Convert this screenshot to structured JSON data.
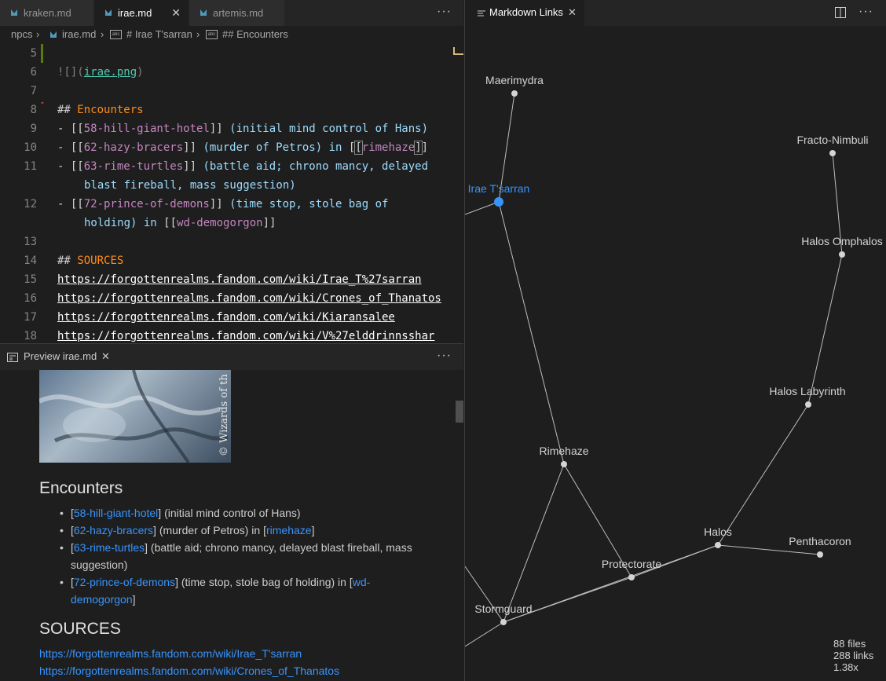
{
  "tabs": [
    {
      "label": "kraken.md"
    },
    {
      "label": "irae.md"
    },
    {
      "label": "artemis.md"
    }
  ],
  "breadcrumb": {
    "folder": "npcs",
    "file": "irae.md",
    "h1": "# Irae T'sarran",
    "h2": "## Encounters"
  },
  "editor": {
    "lines": [
      {
        "n": "5"
      },
      {
        "n": "6"
      },
      {
        "n": "7"
      },
      {
        "n": "8"
      },
      {
        "n": "9"
      },
      {
        "n": "10"
      },
      {
        "n": "11"
      },
      {
        "n": "12"
      },
      {
        "n": "13"
      },
      {
        "n": "14"
      },
      {
        "n": "15"
      },
      {
        "n": "16"
      },
      {
        "n": "17"
      },
      {
        "n": "18"
      }
    ],
    "img_prefix": "![](",
    "img_link": "irae.png",
    "img_suffix": ")",
    "h_encounters_hash": "##",
    "h_encounters_text": "Encounters",
    "e1_link": "58-hill-giant-hotel",
    "e1_text": " (initial mind control of Hans)",
    "e2_link": "62-hazy-bracers",
    "e2_text": " (murder of Petros) in ",
    "e2_link2": "rimehaze",
    "e3_link": "63-rime-turtles",
    "e3_text": " (battle aid; chrono mancy, delayed",
    "e3_cont": "blast fireball, mass suggestion)",
    "e4_link": "72-prince-of-demons",
    "e4_text": " (time stop, stole bag of",
    "e4_cont_text": "holding) in ",
    "e4_link2": "wd-demogorgon",
    "h_sources_hash": "##",
    "h_sources_text": "SOURCES",
    "urls": [
      "https://forgottenrealms.fandom.com/wiki/Irae_T%27sarran",
      "https://forgottenrealms.fandom.com/wiki/Crones_of_Thanatos",
      "https://forgottenrealms.fandom.com/wiki/Kiaransalee",
      "https://forgottenrealms.fandom.com/wiki/V%27elddrinnsshar"
    ]
  },
  "preview_tab": {
    "label": "Preview irae.md"
  },
  "preview": {
    "image_watermark": "© Wizards of th",
    "h_encounters": "Encounters",
    "items": [
      {
        "link": "58-hill-giant-hotel",
        "text": "] (initial mind control of Hans)"
      },
      {
        "link": "62-hazy-bracers",
        "text": "] (murder of Petros) in [",
        "link2": "rimehaze",
        "tail": "]"
      },
      {
        "link": "63-rime-turtles",
        "text": "] (battle aid; chrono mancy, delayed blast fireball, mass suggestion)"
      },
      {
        "link": "72-prince-of-demons",
        "text": "] (time stop, stole bag of holding) in [",
        "link2": "wd-demogorgon",
        "tail": "]"
      }
    ],
    "h_sources": "SOURCES",
    "urls": [
      "https://forgottenrealms.fandom.com/wiki/Irae_T'sarran",
      "https://forgottenrealms.fandom.com/wiki/Crones_of_Thanatos"
    ]
  },
  "graph_tab": {
    "label": "Markdown Links"
  },
  "graph": {
    "nodes": [
      {
        "id": "maerimydra",
        "label": "Maerimydra"
      },
      {
        "id": "fracto",
        "label": "Fracto-Nimbuli"
      },
      {
        "id": "irae",
        "label": "Irae T'sarran"
      },
      {
        "id": "omphalos",
        "label": "Halos Omphalos"
      },
      {
        "id": "labyrinth",
        "label": "Halos Labyrinth"
      },
      {
        "id": "rimehaze",
        "label": "Rimehaze"
      },
      {
        "id": "halos",
        "label": "Halos"
      },
      {
        "id": "penthacoron",
        "label": "Penthacoron"
      },
      {
        "id": "protectorate",
        "label": "Protectorate"
      },
      {
        "id": "stormguard",
        "label": "Stormguard"
      }
    ],
    "stats": {
      "files": "88 files",
      "links": "288 links",
      "zoom": "1.38x"
    }
  },
  "colors": {
    "accent": "#3794ff",
    "selected_node": "#3794ff",
    "node": "#d4d4d4",
    "edge": "#bdbdbd"
  },
  "icons": [
    "markdown-file-icon",
    "close-icon",
    "more-actions-icon",
    "heading-symbol-icon",
    "split-editor-icon",
    "preview-icon"
  ]
}
